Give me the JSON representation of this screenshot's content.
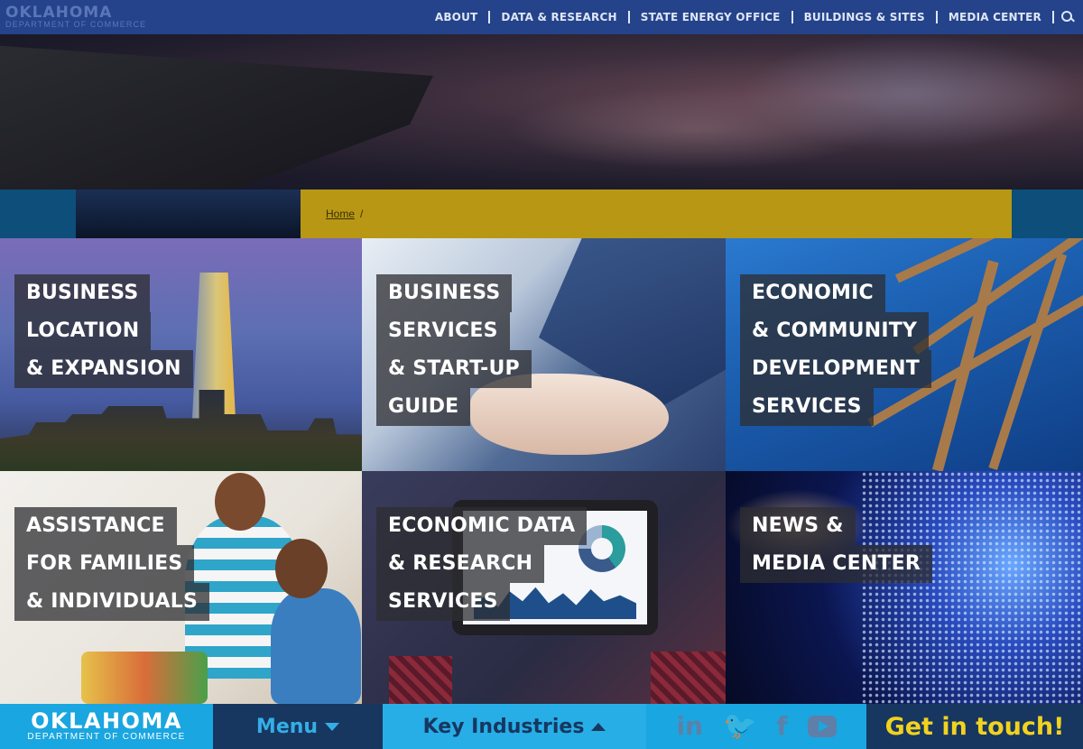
{
  "header": {
    "logo_line1": "OKLAHOMA",
    "logo_line2": "DEPARTMENT OF COMMERCE",
    "nav": [
      "ABOUT",
      "DATA & RESEARCH",
      "STATE ENERGY OFFICE",
      "BUILDINGS & SITES",
      "MEDIA CENTER"
    ],
    "search_icon": "search-icon"
  },
  "breadcrumb": {
    "home": "Home",
    "separator": "/"
  },
  "tiles": [
    {
      "lines": [
        "BUSINESS",
        "LOCATION",
        "& EXPANSION"
      ]
    },
    {
      "lines": [
        "BUSINESS",
        "SERVICES",
        "& START-UP",
        "GUIDE"
      ]
    },
    {
      "lines": [
        "ECONOMIC",
        "& COMMUNITY",
        "DEVELOPMENT",
        "SERVICES"
      ]
    },
    {
      "lines": [
        "ASSISTANCE",
        "FOR FAMILIES",
        "& INDIVIDUALS"
      ]
    },
    {
      "lines": [
        "ECONOMIC DATA",
        "& RESEARCH",
        "SERVICES"
      ]
    },
    {
      "lines": [
        "NEWS &",
        "MEDIA CENTER"
      ]
    }
  ],
  "footer_bar": {
    "logo_line1": "OKLAHOMA",
    "logo_line2": "DEPARTMENT OF COMMERCE",
    "menu": "Menu",
    "key_industries": "Key Industries",
    "social": {
      "linkedin": "in",
      "twitter": "🐦",
      "facebook": "f",
      "youtube": "youtube-icon"
    },
    "cta": "Get in touch!"
  },
  "colors": {
    "nav_bg": "#24438a",
    "footer_light": "#1aa6e0",
    "footer_dark": "#173760",
    "cta_yellow": "#f2d21f",
    "breadcrumb_bg": "#b89714"
  }
}
